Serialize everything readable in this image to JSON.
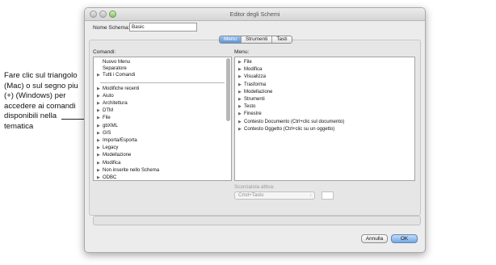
{
  "annotation": {
    "text": "Fare clic sul triangolo (Mac) o sul segno piu (+) (Windows) per accedere ai comandi disponibili nella tematica"
  },
  "window": {
    "title": "Editor degli Schemi"
  },
  "schema_name": {
    "label": "Nome Schema:",
    "value": "Basic"
  },
  "tabs": [
    {
      "label": "Menu",
      "active": true
    },
    {
      "label": "Strumenti",
      "active": false
    },
    {
      "label": "Tasti",
      "active": false
    }
  ],
  "commands": {
    "label": "Comandi:",
    "top_items": [
      "Nuovo Menu",
      "Separatore"
    ],
    "all_commands": "Tutti i Comandi",
    "items": [
      "Modifiche recenti",
      "Aiuto",
      "Architettura",
      "DTM",
      "File",
      "gbXML",
      "GIS",
      "Importa/Esporta",
      "Legacy",
      "Modellazione",
      "Modifica",
      "Non inserite nello Schema",
      "ODBC"
    ]
  },
  "menu": {
    "label": "Menu:",
    "items": [
      "File",
      "Modifica",
      "Visualizza",
      "Trasforma",
      "Modellazione",
      "Strumenti",
      "Testo",
      "Finestre",
      "Contesto Documento (Ctrl+clic sul documento)",
      "Contesto Oggetto (Ctrl+clic su un oggetto)"
    ]
  },
  "shortcut": {
    "label": "Scorciatoia attiva:",
    "value": "Cmd+Tasto"
  },
  "buttons": {
    "cancel": "Annulla",
    "ok": "OK"
  },
  "colors": {
    "accent": "#5d94d6"
  }
}
